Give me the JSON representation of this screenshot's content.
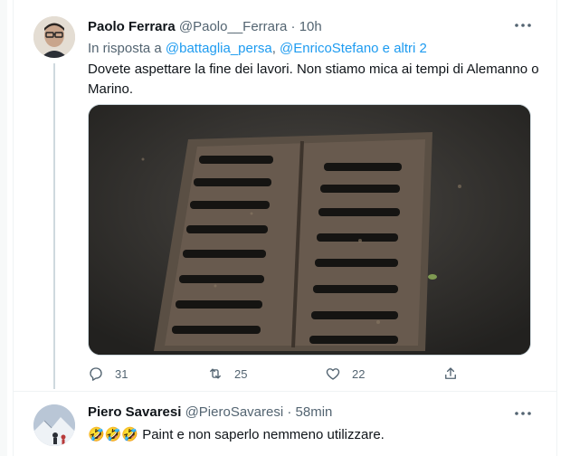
{
  "tweets": [
    {
      "name": "Paolo Ferrara",
      "handle": "@Paolo__Ferrara",
      "separator": "·",
      "time": "10h",
      "reply_prefix": "In risposta a",
      "reply_mentions": [
        "@battaglia_persa",
        "@EnricoStefano"
      ],
      "reply_conj": "e",
      "reply_others": "altri 2",
      "text": "Dovete aspettare la fine dei lavori. Non stiamo mica ai tempi di Alemanno o Marino.",
      "stats": {
        "replies": "31",
        "retweets": "25",
        "likes": "22"
      }
    },
    {
      "name": "Piero Savaresi",
      "handle": "@PieroSavaresi",
      "separator": "·",
      "time": "58min",
      "emoji": "🤣🤣🤣",
      "text": "Paint e non saperlo nemmeno utilizzare."
    }
  ],
  "icons": {
    "more": "more-options-icon",
    "reply": "reply-icon",
    "retweet": "retweet-icon",
    "like": "heart-icon",
    "share": "share-icon"
  },
  "colors": {
    "link": "#1d9bf0",
    "secondary_text": "#536471",
    "border": "#eff3f4"
  }
}
